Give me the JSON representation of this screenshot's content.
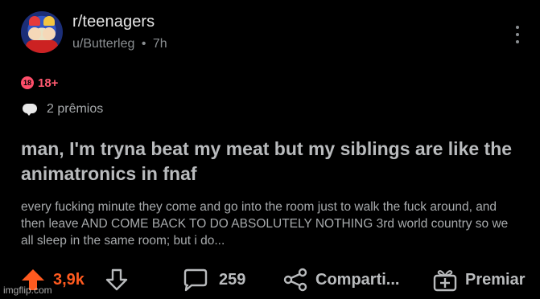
{
  "post": {
    "subreddit": "r/teenagers",
    "author": "u/Butterleg",
    "separator": "•",
    "time": "7h",
    "nsfw_icon_text": "18",
    "nsfw_label": "18+",
    "awards_label": "2  prêmios",
    "title": "man, I'm tryna beat my meat but my siblings are like the animatronics in fnaf",
    "body": "every fucking minute they come and go into the room just to walk the fuck around, and then leave AND COME BACK TO DO ABSOLUTELY NOTHING 3rd world country so we all sleep in the same room; but i do..."
  },
  "actions": {
    "upvotes": "3,9k",
    "comments": "259",
    "share_label": "Comparti...",
    "award_label": "Premiar"
  },
  "watermark": "imgflip.com",
  "colors": {
    "background": "#000000",
    "upvote_accent": "#ff5a1f",
    "nsfw": "#ff4e6a",
    "text_muted": "#8b8f92"
  },
  "icons": {
    "subreddit_avatar": "avatar-icon",
    "more": "kebab-icon",
    "nsfw": "nsfw-icon",
    "awards": "award-bubble-icon",
    "upvote": "arrow-up-icon",
    "downvote": "arrow-down-icon",
    "comments": "comment-bubble-icon",
    "share": "share-icon",
    "award": "gift-icon"
  }
}
